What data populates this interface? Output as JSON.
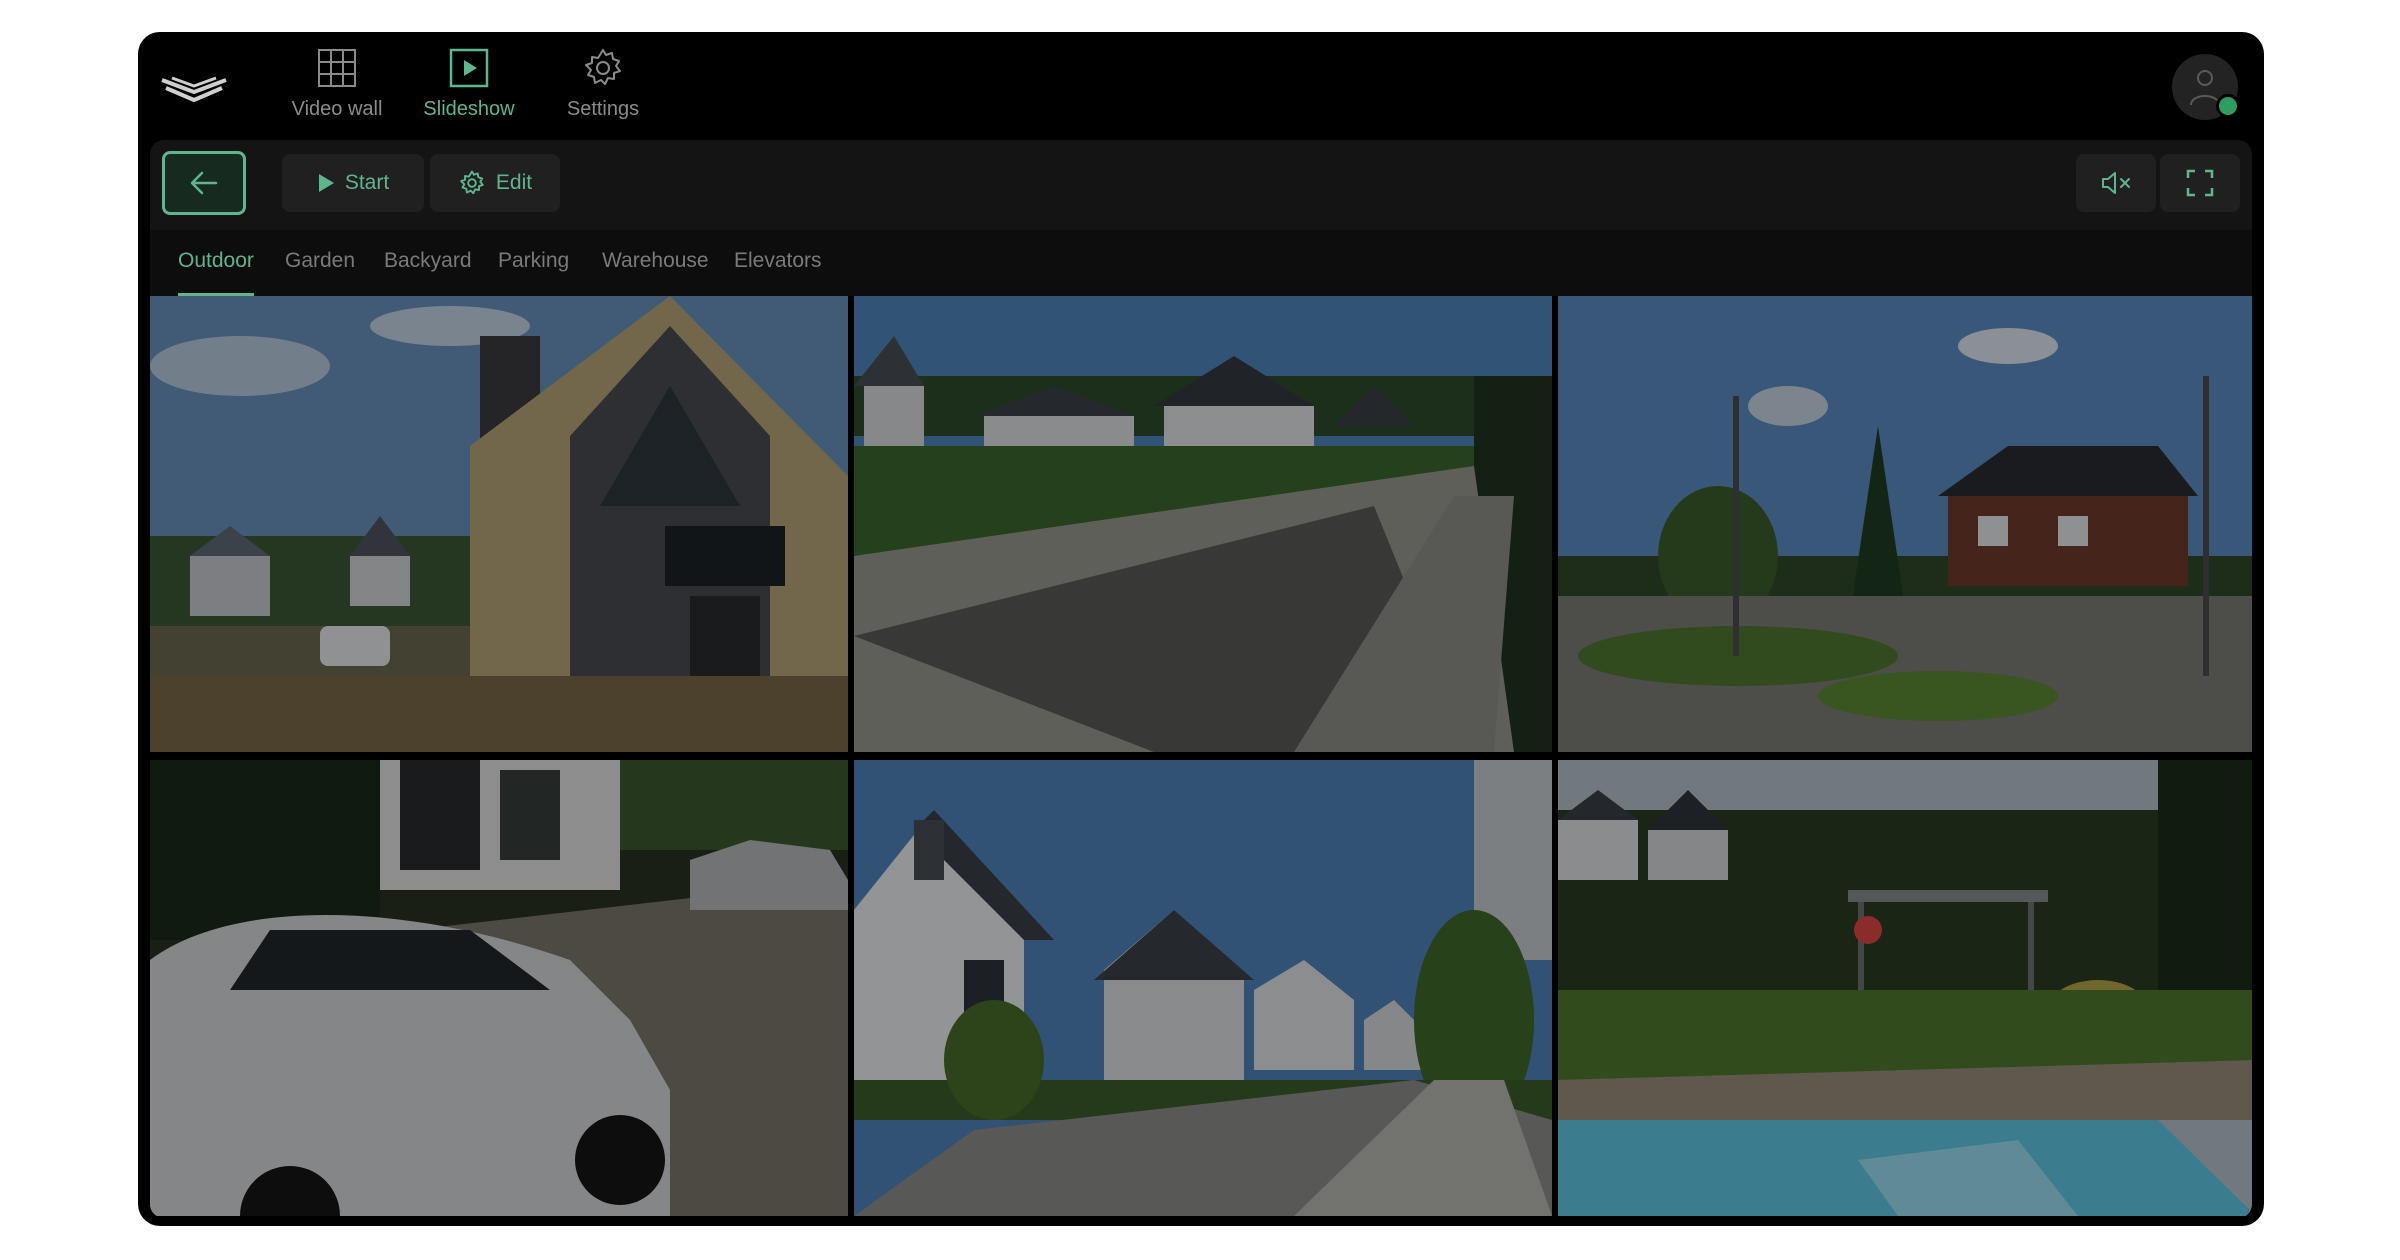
{
  "nav": {
    "items": [
      {
        "label": "Video wall",
        "icon": "grid-icon",
        "active": false
      },
      {
        "label": "Slideshow",
        "icon": "play-square-icon",
        "active": true
      },
      {
        "label": "Settings",
        "icon": "gear-icon",
        "active": false
      }
    ]
  },
  "toolbar": {
    "start_label": "Start",
    "edit_label": "Edit"
  },
  "tabs": [
    "Outdoor",
    "Garden",
    "Backyard",
    "Parking",
    "Warehouse",
    "Elevators"
  ],
  "active_tab": "Outdoor",
  "user": {
    "status": "online"
  },
  "colors": {
    "accent": "#5fb58c",
    "background": "#000000",
    "panel": "#141414",
    "status_online": "#2e9d5f"
  },
  "cameras": [
    {
      "scene": "modern-house-gable"
    },
    {
      "scene": "street-hedge-road"
    },
    {
      "scene": "yard-tree-house"
    },
    {
      "scene": "parked-car-driveway"
    },
    {
      "scene": "street-houses-row"
    },
    {
      "scene": "backyard-pool"
    }
  ]
}
